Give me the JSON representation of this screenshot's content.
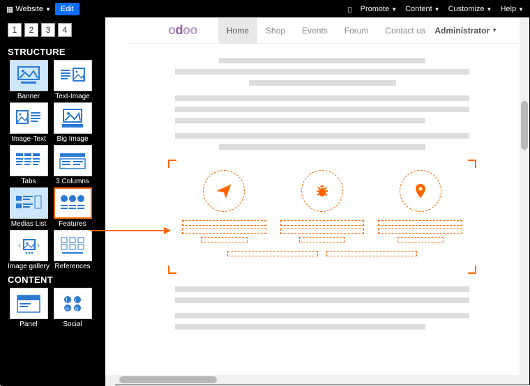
{
  "topbar": {
    "website_label": "Website",
    "edit_label": "Edit",
    "mobile_icon": "mobile",
    "menus": [
      "Promote",
      "Content",
      "Customize",
      "Help"
    ]
  },
  "sidebar": {
    "pages": [
      "1",
      "2",
      "3",
      "4"
    ],
    "section_structure": "STRUCTURE",
    "section_content": "CONTENT",
    "structure_tiles": [
      {
        "label": "Banner"
      },
      {
        "label": "Text-Image"
      },
      {
        "label": "Image-Text"
      },
      {
        "label": "Big Image"
      },
      {
        "label": "Tabs"
      },
      {
        "label": "3 Columns"
      },
      {
        "label": "Medias List"
      },
      {
        "label": "Features"
      },
      {
        "label": "Image gallery"
      },
      {
        "label": "References"
      }
    ],
    "content_tiles": [
      {
        "label": "Panel"
      },
      {
        "label": "Social"
      }
    ]
  },
  "site": {
    "logo": "odoo",
    "nav": [
      "Home",
      "Shop",
      "Events",
      "Forum",
      "Contact us"
    ],
    "active_nav": "Home",
    "admin_label": "Administrator"
  }
}
